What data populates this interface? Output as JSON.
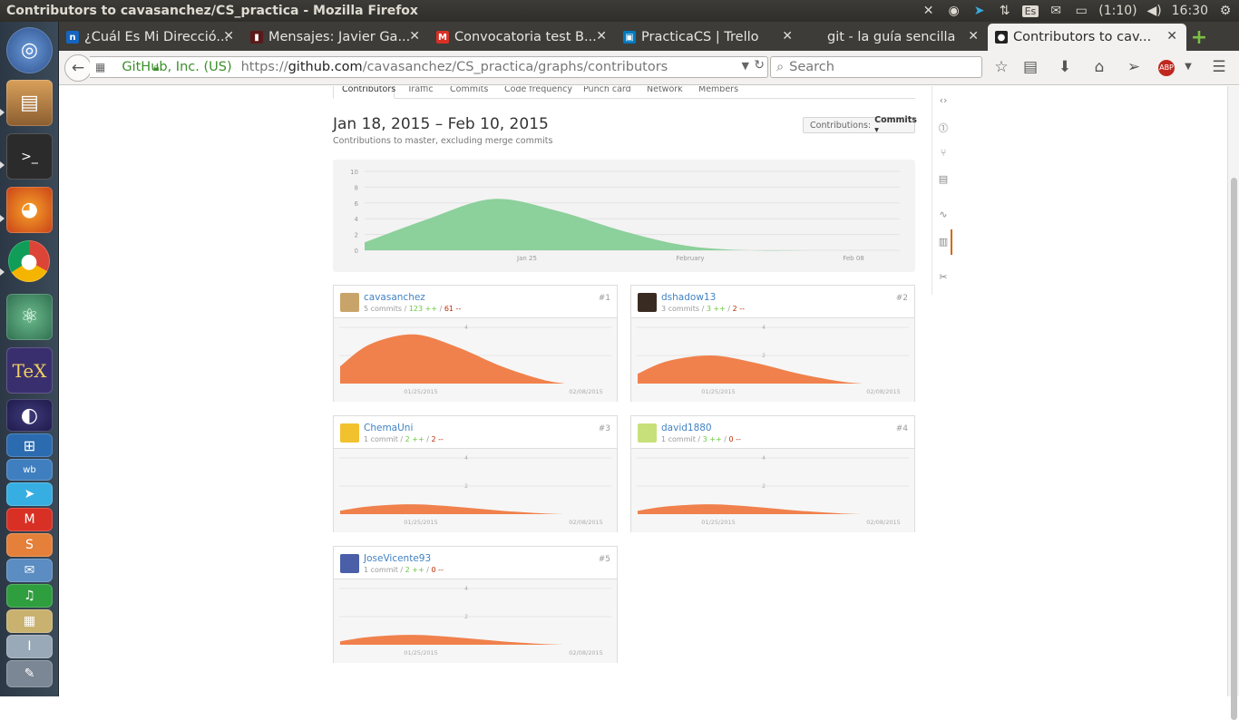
{
  "window": {
    "title": "Contributors to cavasanchez/CS_practica - Mozilla Firefox"
  },
  "tray": {
    "keyboard": "Es",
    "battery": "(1:10)",
    "clock": "16:30"
  },
  "tabs": [
    {
      "label": "¿Cuál Es Mi Direcció...",
      "favicon_color": "#1565c0",
      "favicon_glyph": "n"
    },
    {
      "label": "Mensajes: Javier Ga...",
      "favicon_color": "#5a1a1a",
      "favicon_glyph": "▮"
    },
    {
      "label": "Convocatoria test B...",
      "favicon_color": "#d93025",
      "favicon_glyph": "M"
    },
    {
      "label": "PracticaCS | Trello",
      "favicon_color": "#0079bf",
      "favicon_glyph": "▣"
    },
    {
      "label": "git - la guía sencilla",
      "favicon_color": "#3d3c38",
      "favicon_glyph": ""
    },
    {
      "label": "Contributors to cav...",
      "favicon_color": "#222222",
      "favicon_glyph": "●",
      "active": true
    }
  ],
  "nav": {
    "identity": "GitHub, Inc. (US)",
    "url_prefix": "https://",
    "url_host": "github.com",
    "url_path": "/cavasanchez/CS_practica/graphs/contributors",
    "search_placeholder": "Search"
  },
  "subnav": [
    "Contributors",
    "Traffic",
    "Commits",
    "Code frequency",
    "Punch card",
    "Network",
    "Members"
  ],
  "page": {
    "date_range": "Jan 18, 2015 – Feb 10, 2015",
    "subtitle": "Contributions to master, excluding merge commits",
    "contributions_label": "Contributions:",
    "contributions_value": "Commits ▾"
  },
  "chart_data": [
    {
      "type": "area",
      "color": "#8cd09b",
      "x": [
        "Jan 18",
        "Jan 21",
        "Jan 25",
        "Jan 29",
        "Feb 01",
        "Feb 05",
        "Feb 08",
        "Feb 10"
      ],
      "values": [
        1,
        4,
        6.5,
        5,
        2.5,
        0.6,
        0,
        0
      ],
      "xticks": [
        "Jan 25",
        "February",
        "Feb 08"
      ],
      "yticks": [
        "10",
        "8",
        "6",
        "4",
        "2",
        "0"
      ],
      "ylim": [
        0,
        10
      ]
    }
  ],
  "contributors": [
    {
      "name": "cavasanchez",
      "commits": "5 commits",
      "additions": "123 ++",
      "deletions": "61 --",
      "rank": "#1",
      "avatar_color": "#c9a46a",
      "peak": 3.5,
      "ymax": 4,
      "yticks": [
        "4",
        "2"
      ],
      "xticks": [
        "01/25/2015",
        "02/08/2015"
      ]
    },
    {
      "name": "dshadow13",
      "commits": "3 commits",
      "additions": "3 ++",
      "deletions": "2 --",
      "rank": "#2",
      "avatar_color": "#3a2b22",
      "peak": 2,
      "ymax": 4,
      "yticks": [
        "4",
        "2"
      ],
      "xticks": [
        "01/25/2015",
        "02/08/2015"
      ]
    },
    {
      "name": "ChemaUni",
      "commits": "1 commit",
      "additions": "2 ++",
      "deletions": "2 --",
      "rank": "#3",
      "avatar_color": "#f2c12e",
      "peak": 0.7,
      "ymax": 4,
      "yticks": [
        "4",
        "2"
      ],
      "xticks": [
        "01/25/2015",
        "02/08/2015"
      ]
    },
    {
      "name": "david1880",
      "commits": "1 commit",
      "additions": "3 ++",
      "deletions": "0 --",
      "rank": "#4",
      "avatar_color": "#c8e07a",
      "peak": 0.7,
      "ymax": 4,
      "yticks": [
        "4",
        "2"
      ],
      "xticks": [
        "01/25/2015",
        "02/08/2015"
      ]
    },
    {
      "name": "JoseVicente93",
      "commits": "1 commit",
      "additions": "2 ++",
      "deletions": "0 --",
      "rank": "#5",
      "avatar_color": "#4a5fa8",
      "peak": 0.7,
      "ymax": 4,
      "yticks": [
        "4",
        "2"
      ],
      "xticks": [
        "01/25/2015",
        "02/08/2015"
      ]
    }
  ],
  "sidenav_icons": [
    "code-icon",
    "issues-icon",
    "pull-request-icon",
    "wiki-icon",
    "pulse-icon",
    "graphs-icon",
    "settings-icon"
  ]
}
